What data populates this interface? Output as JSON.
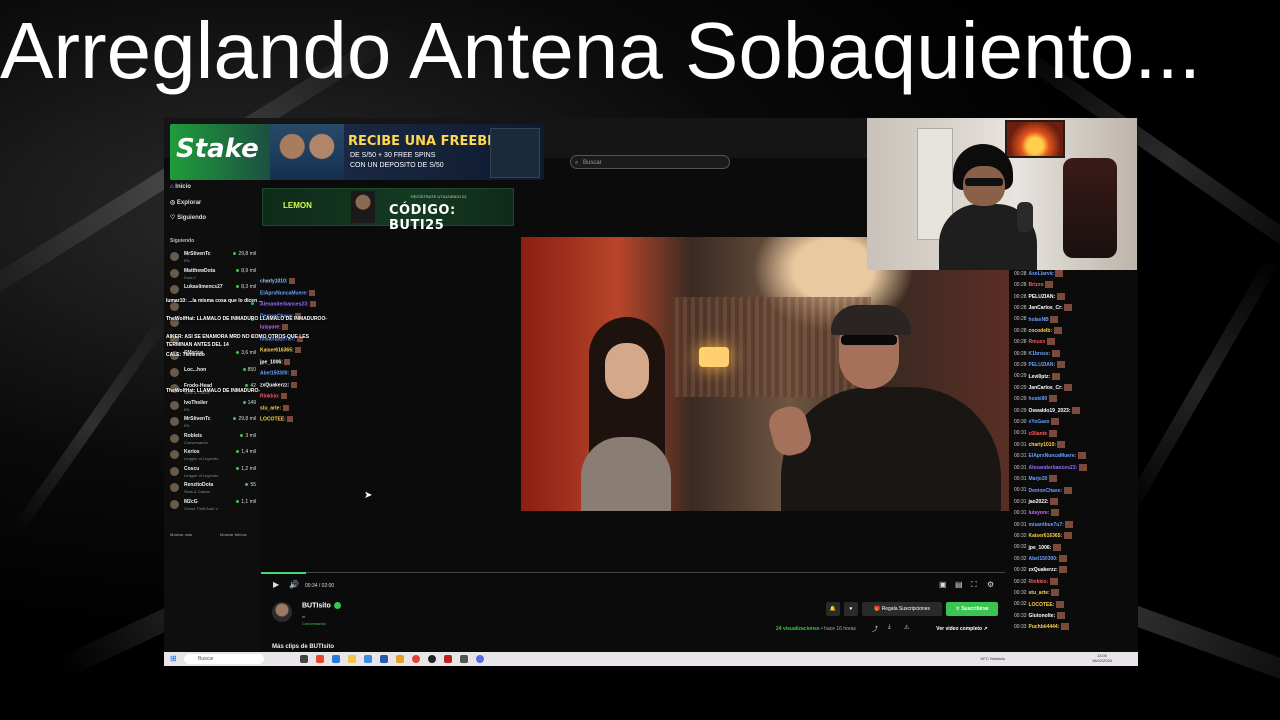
{
  "title": "Arreglando Antena Sobaquiento...",
  "browser": {
    "search_placeholder": "Buscar"
  },
  "ads": {
    "stake": {
      "logo": "Stake",
      "headline": "RECIBE UNA FREEBET",
      "sub_line1": "DE S/50 + 30 FREE SPINS",
      "sub_line2": "CON UN DEPOSITO DE S/50"
    },
    "lemon": {
      "logo": "LEMON",
      "small": "REGÍSTRATE UTILIZANDO EL",
      "code": "CÓDIGO: BUTI25"
    }
  },
  "sidebar": {
    "nav": [
      {
        "label": "Inicio",
        "icon": "home-icon"
      },
      {
        "label": "Explorar",
        "icon": "compass-icon"
      },
      {
        "label": "Siguiendo",
        "icon": "heart-icon"
      }
    ],
    "following_heading": "Siguiendo",
    "following": [
      {
        "name": "MrStivenTc",
        "category": "IRL",
        "count": "29,8 mil"
      },
      {
        "name": "MatthewDota",
        "category": "Dota 2",
        "count": "8,9 mil"
      },
      {
        "name": "Lukaslimencs27",
        "category": "",
        "count": "8,3 mil"
      },
      {
        "name": "",
        "category": "",
        "count": ""
      },
      {
        "name": "",
        "category": "",
        "count": ""
      },
      {
        "name": "",
        "category": "",
        "count": ""
      },
      {
        "name": "SMarius",
        "category": "",
        "count": "3,6 mil"
      },
      {
        "name": "Loc...hon",
        "category": "",
        "count": "850"
      },
      {
        "name": "Frodo-Head",
        "category": "Slots & Casino",
        "count": "42"
      },
      {
        "name": "IvoTheiler",
        "category": "IRL",
        "count": "149"
      },
      {
        "name": "MrStivenTc",
        "category": "IRL",
        "count": "29,8 mil"
      },
      {
        "name": "Robleis",
        "category": "Conversando",
        "count": "3 mil"
      },
      {
        "name": "Kerios",
        "category": "League of Legends",
        "count": "1,4 mil"
      },
      {
        "name": "Coscu",
        "category": "League of Legends",
        "count": "1,2 mil"
      },
      {
        "name": "RenzitoDota",
        "category": "Slots & Casino",
        "count": "55"
      },
      {
        "name": "M2cG",
        "category": "Grand Theft Auto V",
        "count": "1,1 mil"
      }
    ],
    "show_more": "Mostrar más",
    "show_less": "Mostrar Menos"
  },
  "chat_left": [
    {
      "user": "charly1010:",
      "color": "#8ec5ff"
    },
    {
      "user": "ElAprsNuncaMuere:",
      "color": "#6aa0ff"
    },
    {
      "user": "Alexanderbances23:",
      "color": "#9a6cff"
    },
    {
      "user": "DemonChase:",
      "color": "#5aa8ff"
    },
    {
      "user": "luisyore:",
      "color": "#d06cff"
    },
    {
      "user": "misantbue7u7:",
      "color": "#6aa0ff"
    },
    {
      "user": "Kaiser616365:",
      "color": "#ffd24a"
    },
    {
      "user": "jpe_1006:",
      "color": "#ffffff"
    },
    {
      "user": "Abel150300:",
      "color": "#6aa0ff"
    },
    {
      "user": "zxQuakerzz:",
      "color": "#ffffff"
    },
    {
      "user": "Rinkkio:",
      "color": "#ff5a5a"
    },
    {
      "user": "stu_arte:",
      "color": "#ffd24a"
    },
    {
      "user": "LOCOTEE:",
      "color": "#ffd24a"
    }
  ],
  "chat_overlay_left": [
    "lumar10: ...la misma cosa que lo dicen ...",
    "TheWolfHat: LLAMALO DE INMADURO LLAMALO DE INMADUROO-",
    "AIKER: ASI SE ENAMORA MRD NO COMO OTROS QUE LES",
    "TERMINAN ANTES DEL 14",
    "CALE: Tienendo",
    "TheWolfHat: LLAMALO DE INMADURO-"
  ],
  "player": {
    "time": "00:34 / 02:00",
    "progress": 0.06
  },
  "channel": {
    "name": "BUTIsito",
    "sub": "nt",
    "category": "Conversando",
    "views": "24 visualizaciones",
    "ago": "• hace 16 horas",
    "gift_label": "Regala Suscripciones",
    "subscribe_label": "Suscribirse",
    "full_video_label": "Ver video completo",
    "more_clips": "Más clips de BUTIsito"
  },
  "taskbar": {
    "search": "Buscar",
    "weather": "15°C Nublado",
    "time": "13:00",
    "date": "18/02/2024"
  },
  "chat_right": [
    {
      "time": "00:28",
      "user": "AxeLlarvic",
      "color": "#6aa0ff"
    },
    {
      "time": "00:28",
      "user": "Brizzo",
      "color": "#ff5a5a"
    },
    {
      "time": "00:28",
      "user": "PELUZIAN:",
      "color": "#ffffff"
    },
    {
      "time": "00:28",
      "user": "JanCarlos_Cr:",
      "color": "#ffffff"
    },
    {
      "time": "00:28",
      "user": "holasNB",
      "color": "#6aa0ff"
    },
    {
      "time": "00:28",
      "user": "cocodelb:",
      "color": "#ffd24a"
    },
    {
      "time": "00:28",
      "user": "Rmuxx",
      "color": "#ff5a5a"
    },
    {
      "time": "00:28",
      "user": "K1bross:",
      "color": "#6aa0ff"
    },
    {
      "time": "00:29",
      "user": "PELUZIAN:",
      "color": "#6aa0ff"
    },
    {
      "time": "00:29",
      "user": "Levi0ptz:",
      "color": "#ffffff"
    },
    {
      "time": "00:29",
      "user": "JanCarlos_Cr:",
      "color": "#ffffff"
    },
    {
      "time": "00:29",
      "user": "hoskill0",
      "color": "#6aa0ff"
    },
    {
      "time": "00:29",
      "user": "Oswaldo19_2023:",
      "color": "#ffffff"
    },
    {
      "time": "00:30",
      "user": "xYoGasx",
      "color": "#6aa0ff"
    },
    {
      "time": "00:31",
      "user": "c0liante",
      "color": "#ff5a5a"
    },
    {
      "time": "00:31",
      "user": "charly1010:",
      "color": "#ffd24a"
    },
    {
      "time": "00:31",
      "user": "ElAprsNuncaMuere:",
      "color": "#6aa0ff"
    },
    {
      "time": "00:31",
      "user": "Alexanderbances23:",
      "color": "#9a6cff"
    },
    {
      "time": "00:31",
      "user": "Marjo30",
      "color": "#6aa0ff"
    },
    {
      "time": "00:31",
      "user": "DemonChase:",
      "color": "#6aa0ff"
    },
    {
      "time": "00:31",
      "user": "jao2022:",
      "color": "#ffffff"
    },
    {
      "time": "00:31",
      "user": "luisyore:",
      "color": "#d06cff"
    },
    {
      "time": "00:31",
      "user": "misantbue7u7:",
      "color": "#6aa0ff"
    },
    {
      "time": "00:32",
      "user": "Kaiser616365:",
      "color": "#ffd24a"
    },
    {
      "time": "00:32",
      "user": "jpe_1006:",
      "color": "#ffffff"
    },
    {
      "time": "00:32",
      "user": "Abel150300:",
      "color": "#6aa0ff"
    },
    {
      "time": "00:32",
      "user": "zxQuakerzz:",
      "color": "#ffffff"
    },
    {
      "time": "00:32",
      "user": "Rinkkio:",
      "color": "#ff5a5a"
    },
    {
      "time": "00:32",
      "user": "stu_arte:",
      "color": "#ffd24a"
    },
    {
      "time": "00:32",
      "user": "LOCOTEE:",
      "color": "#ffd24a"
    },
    {
      "time": "00:33",
      "user": "Glutonolte:",
      "color": "#ffffff"
    },
    {
      "time": "00:33",
      "user": "Puchbii4444:",
      "color": "#ffd24a"
    }
  ]
}
